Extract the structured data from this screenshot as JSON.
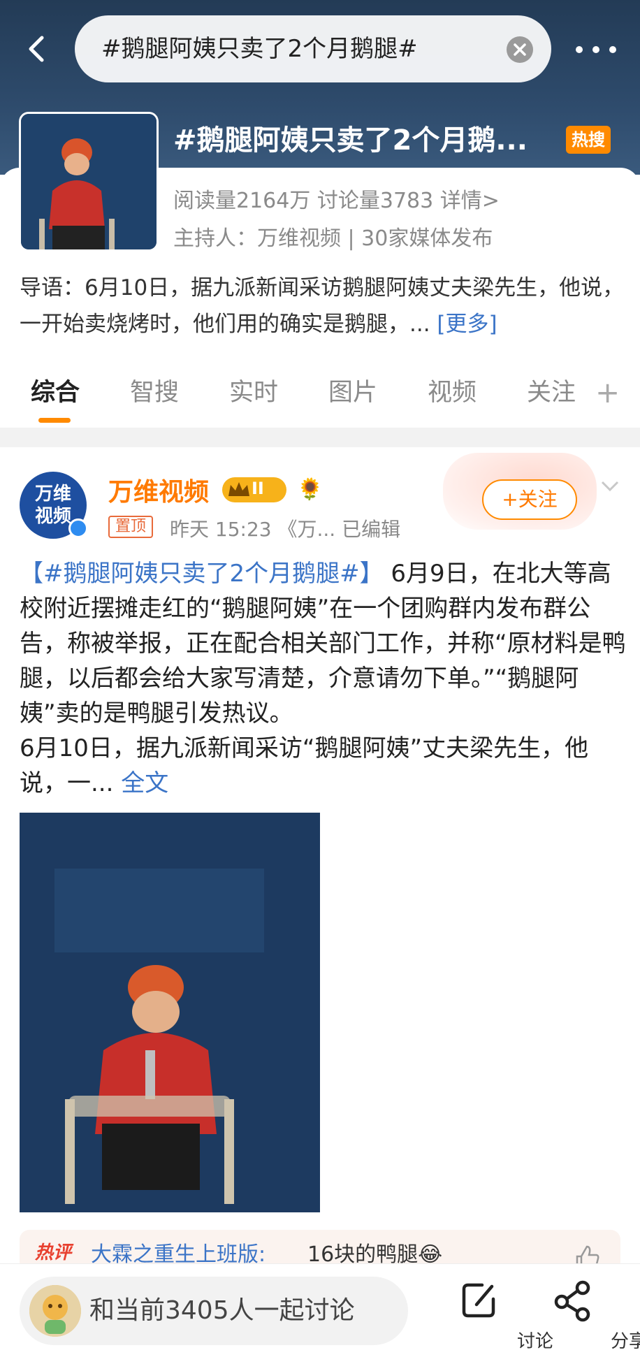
{
  "header": {
    "search_text": "#鹅腿阿姨只卖了2个月鹅腿#"
  },
  "topic": {
    "title": "#鹅腿阿姨只卖了2个月鹅...",
    "hot_badge": "热搜",
    "stats": "阅读量2164万  讨论量3783  详情>",
    "host": "主持人：万维视频 | 30家媒体发布",
    "intro_text": "导语：6月10日，据九派新闻采访鹅腿阿姨丈夫梁先生，他说，一开始卖烧烤时，他们用的确实是鹅腿，...",
    "intro_more": "[更多]"
  },
  "tabs": [
    "综合",
    "智搜",
    "实时",
    "图片",
    "视频",
    "关注"
  ],
  "post": {
    "avatar_text_1": "万维",
    "avatar_text_2": "视频",
    "author": "万维视频",
    "level": "II",
    "pin_label": "置顶",
    "meta": "昨天 15:23  《万...  已编辑",
    "follow_label": "+关注",
    "hashtag": "【#鹅腿阿姨只卖了2个月鹅腿#】",
    "body_1": " 6月9日，在北大等高校附近摆摊走红的“鹅腿阿姨”在一个团购群内发布群公告，称被举报，正在配合相关部门工作，并称“原材料是鸭腿，以后都会给大家写清楚，介意请勿下单。”“鹅腿阿姨”卖的是鸭腿引发热议。",
    "body_2": "6月10日，据九派新闻采访“鹅腿阿姨”丈夫梁先生，他说，一...",
    "full_text_link": "全文"
  },
  "hot_comment": {
    "label": "热评",
    "author": "大霖之重生上班版:",
    "text": "16块的鸭腿😂"
  },
  "bottom": {
    "discuss_text": "和当前3405人一起讨论",
    "discuss_label": "讨论",
    "share_label": "分享"
  }
}
